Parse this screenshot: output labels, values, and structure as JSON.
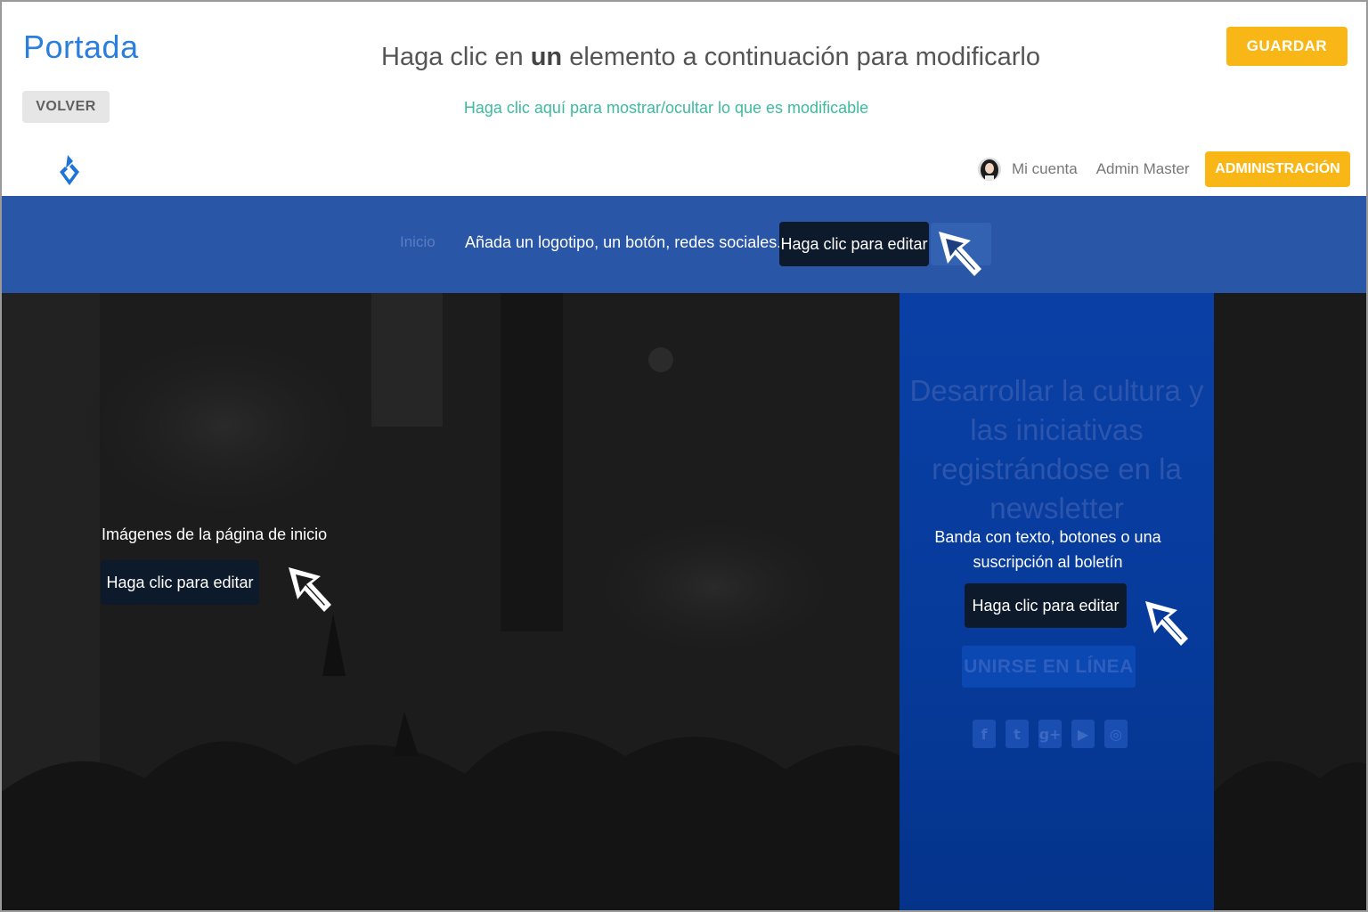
{
  "editor": {
    "page_title": "Portada",
    "back_label": "VOLVER",
    "instruction_pre": "Haga clic en ",
    "instruction_bold": "un",
    "instruction_post": " elemento a continuación para modificarlo",
    "toggle_link": "Haga clic aquí para mostrar/ocultar lo que es modificable",
    "save_label": "GUARDAR"
  },
  "site_header": {
    "logo_icon": "droplet-logo-icon",
    "my_account": "Mi cuenta",
    "user_name": "Admin Master",
    "admin_label": "ADMINISTRACIÓN"
  },
  "nav": {
    "home_item": "Inicio",
    "hint": "Añada un logotipo, un botón, redes sociales...",
    "edit_label": "Haga clic para editar"
  },
  "hero": {
    "hint": "Imágenes de la página de inicio",
    "edit_label": "Haga clic para editar"
  },
  "newsletter": {
    "title": "Desarrollar la cultura y las iniciativas registrándose en la newsletter",
    "hint": "Banda con texto, botones o una suscripción al boletín",
    "edit_label": "Haga clic para editar",
    "join_label": "UNIRSE EN LÍNEA",
    "socials": [
      {
        "name": "facebook-icon",
        "glyph": "f"
      },
      {
        "name": "twitter-icon",
        "glyph": "t"
      },
      {
        "name": "google-plus-icon",
        "glyph": "g+"
      },
      {
        "name": "youtube-icon",
        "glyph": "▶"
      },
      {
        "name": "instagram-icon",
        "glyph": "◎"
      }
    ]
  },
  "colors": {
    "accent_yellow": "#f9b717",
    "title_blue": "#2a7fde",
    "link_teal": "#3dbb9e",
    "nav_blue": "#2a56a8",
    "panel_blue": "#063a9a",
    "edit_button": "#0d1a2c"
  }
}
